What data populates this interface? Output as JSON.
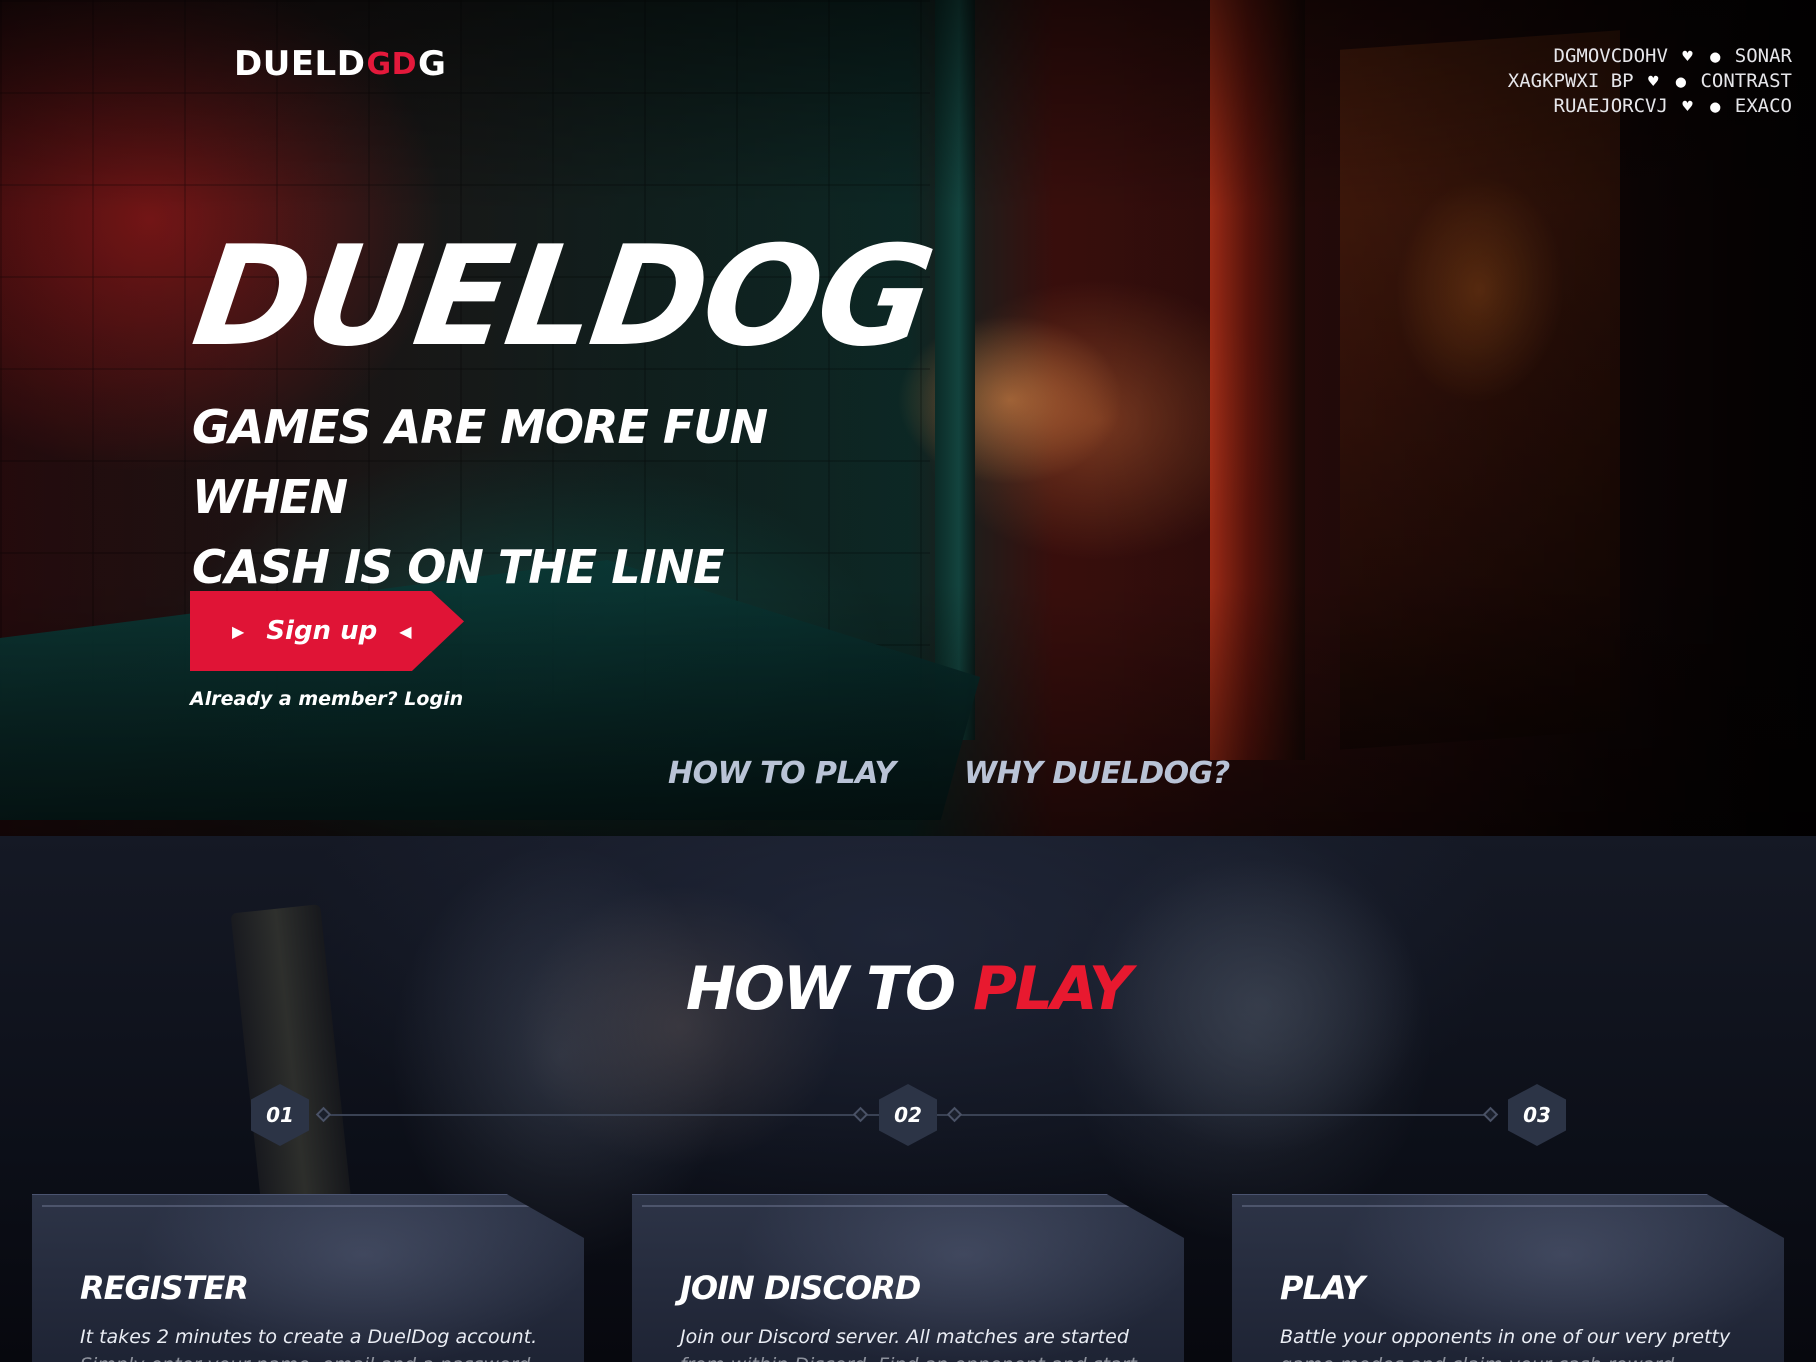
{
  "header": {
    "logo_text_left": "DUELD",
    "logo_mark": "GD",
    "logo_text_right": "G"
  },
  "ticker": [
    {
      "left": "DGMOVCDOHV",
      "right": "SONAR"
    },
    {
      "left": "XAGKPWXI BP",
      "right": "CONTRAST"
    },
    {
      "left": "RUAEJORCVJ",
      "right": "EXACO"
    }
  ],
  "hero": {
    "title": "DUELDOG",
    "subtitle_line1": "GAMES ARE MORE FUN WHEN",
    "subtitle_line2": "CASH IS ON THE LINE",
    "signup_label": "Sign up",
    "login_label": "Already a member? Login",
    "nav": [
      "HOW TO PLAY",
      "WHY DUELDOG?"
    ]
  },
  "how_to_play": {
    "title_main": "HOW TO ",
    "title_accent": "PLAY",
    "steps": [
      "01",
      "02",
      "03"
    ],
    "cards": [
      {
        "title": "REGISTER",
        "text": "It takes 2 minutes to create a DuelDog account.",
        "text_faded": "Simply enter your name, email and a password"
      },
      {
        "title": "JOIN DISCORD",
        "text": "Join our Discord server. All matches are started",
        "text_faded": "from within Discord. Find an opponent and start a"
      },
      {
        "title": "PLAY",
        "text": "Battle your opponents in one of our very pretty",
        "text_faded": "game modes and claim your cash reward"
      }
    ]
  },
  "colors": {
    "accent": "#e01436",
    "accent_text": "#e8192f",
    "nav_text": "#b9c3d6",
    "card_bg": "#2d3447"
  },
  "icons": [
    "gun-icon",
    "grenade-icon",
    "play-arrow-icon"
  ]
}
